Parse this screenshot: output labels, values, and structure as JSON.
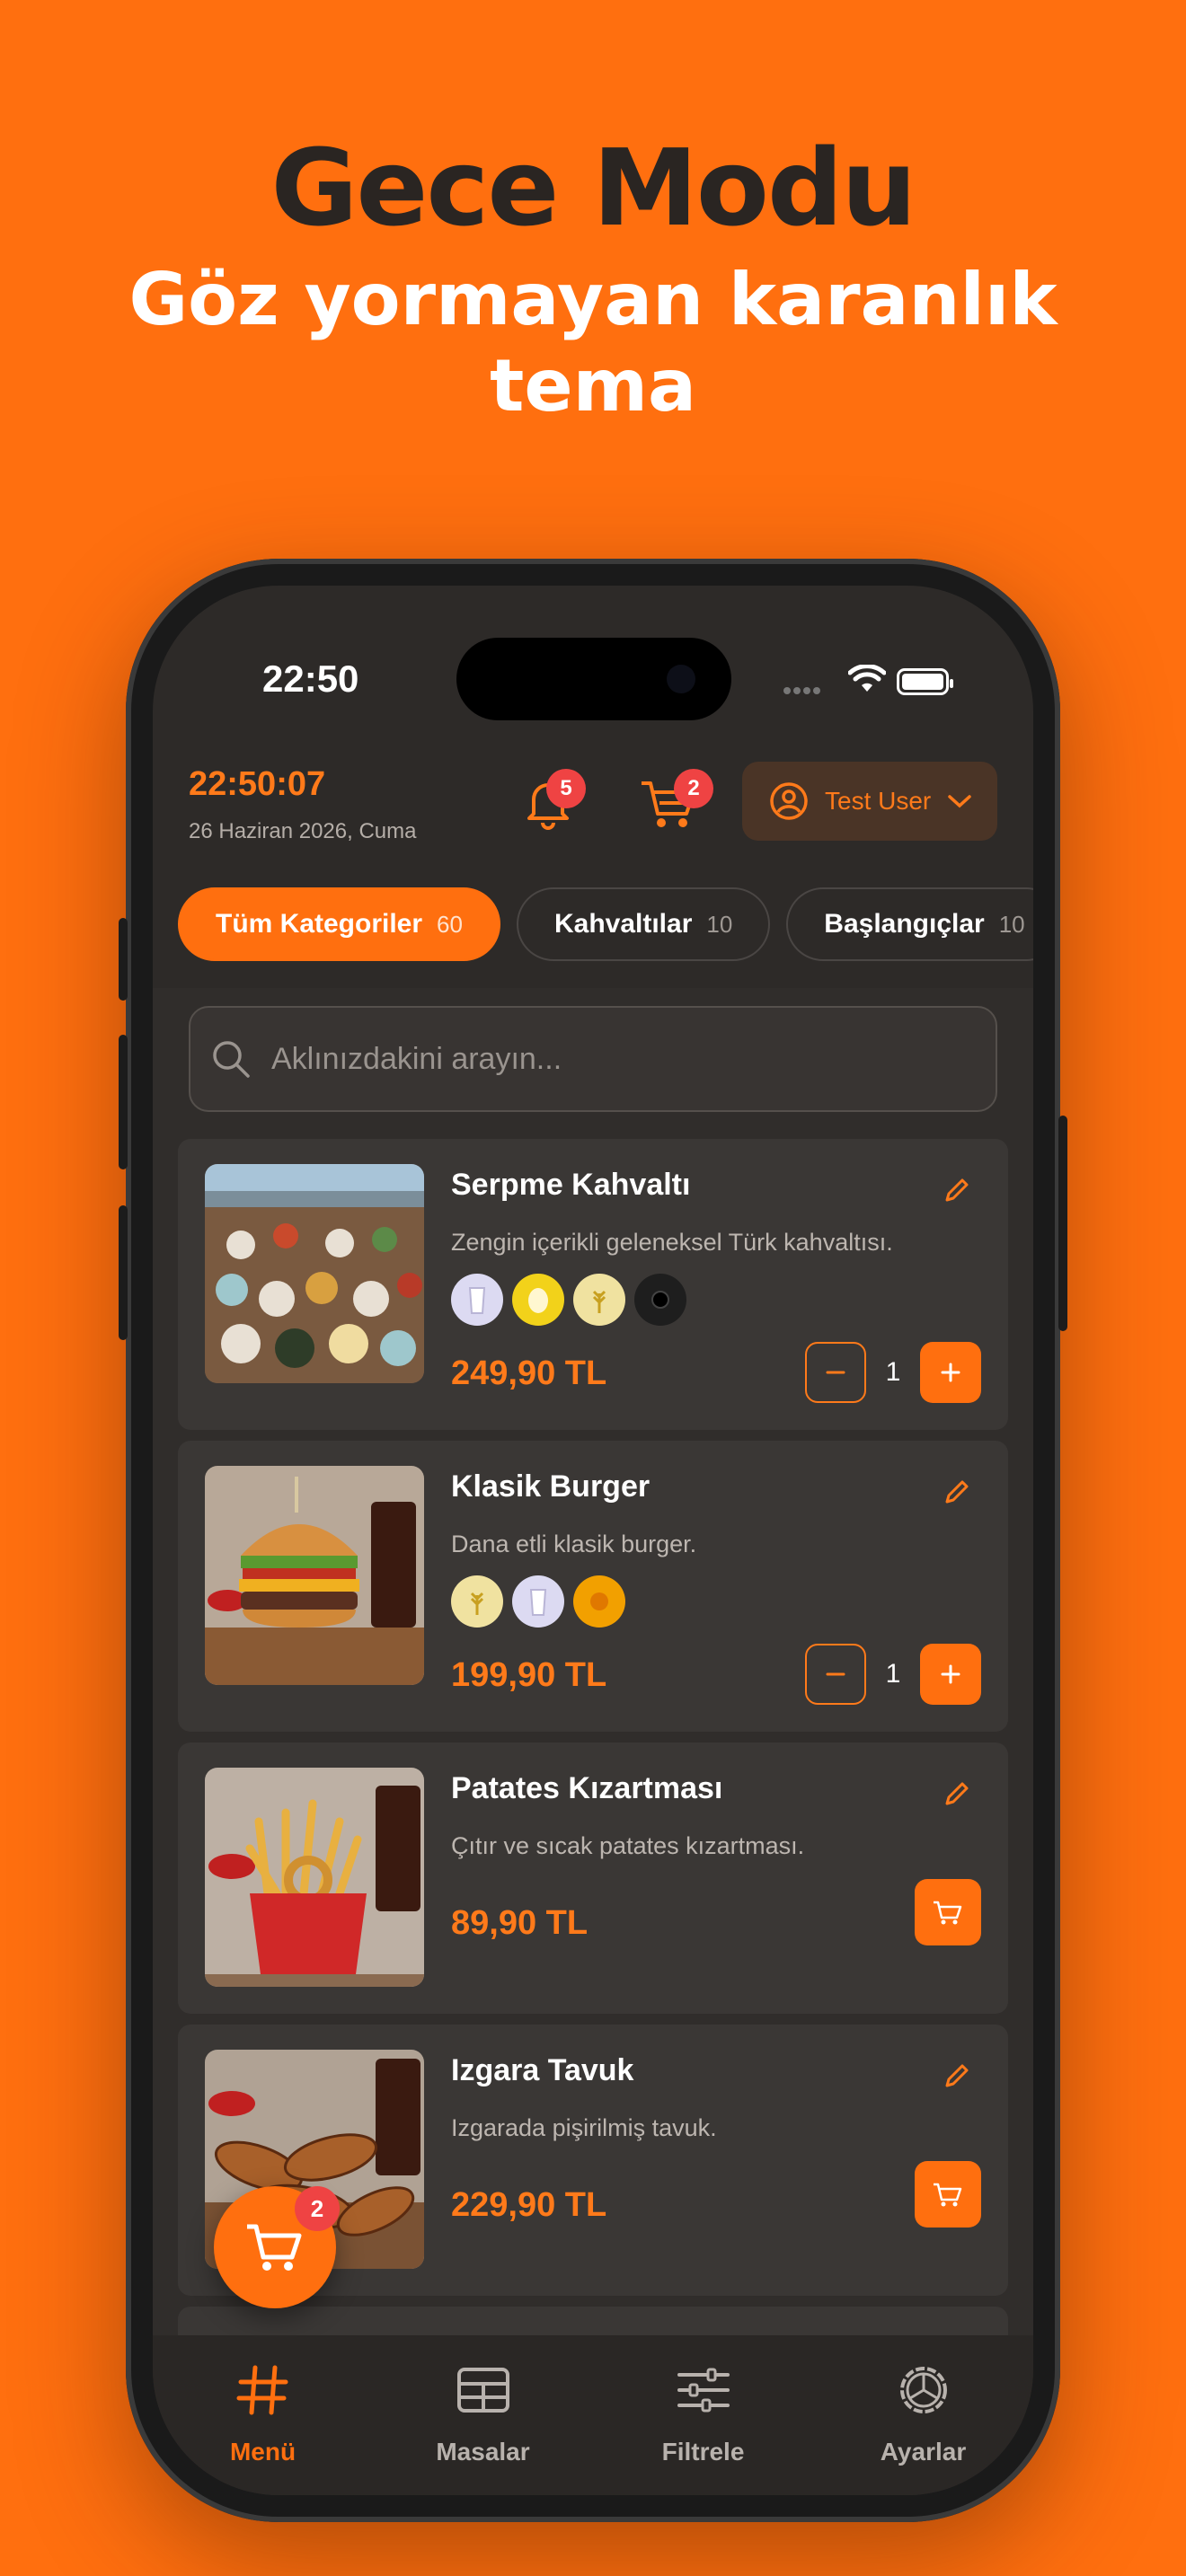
{
  "hero": {
    "title": "Gece Modu",
    "subtitle": "Göz yormayan karanlık tema"
  },
  "statusbar": {
    "time": "22:50"
  },
  "header": {
    "clock": "22:50:07",
    "date": "26 Haziran 2026, Cuma",
    "notifications_count": "5",
    "cart_count": "2",
    "user_name": "Test User"
  },
  "categories": [
    {
      "label": "Tüm Kategoriler",
      "count": "60",
      "active": true
    },
    {
      "label": "Kahvaltılar",
      "count": "10"
    },
    {
      "label": "Başlangıçlar",
      "count": "10"
    }
  ],
  "search": {
    "placeholder": "Aklınızdakini arayın..."
  },
  "products": [
    {
      "title": "Serpme Kahvaltı",
      "desc": "Zengin içerikli geleneksel Türk kahvaltısı.",
      "price": "249,90 TL",
      "qty": "1",
      "allergens": [
        "milk-icon",
        "egg-icon",
        "gluten-icon",
        "sesame-icon"
      ]
    },
    {
      "title": "Klasik Burger",
      "desc": "Dana etli klasik burger.",
      "price": "199,90 TL",
      "qty": "1",
      "allergens": [
        "gluten-icon",
        "milk-icon",
        "mustard-icon"
      ]
    },
    {
      "title": "Patates Kızartması",
      "desc": "Çıtır ve sıcak patates kızartması.",
      "price": "89,90 TL"
    },
    {
      "title": "Izgara Tavuk",
      "desc": "Izgarada pişirilmiş tavuk.",
      "price": "229,90 TL"
    }
  ],
  "floating_cart": {
    "count": "2"
  },
  "tabbar": [
    {
      "label": "Menü",
      "icon": "hash-icon",
      "active": true
    },
    {
      "label": "Masalar",
      "icon": "table-grid-icon"
    },
    {
      "label": "Filtrele",
      "icon": "sliders-icon"
    },
    {
      "label": "Ayarlar",
      "icon": "settings-icon"
    }
  ],
  "colors": {
    "accent": "#FF6F0F",
    "background": "#2D2A28",
    "badge": "#EF4343"
  }
}
